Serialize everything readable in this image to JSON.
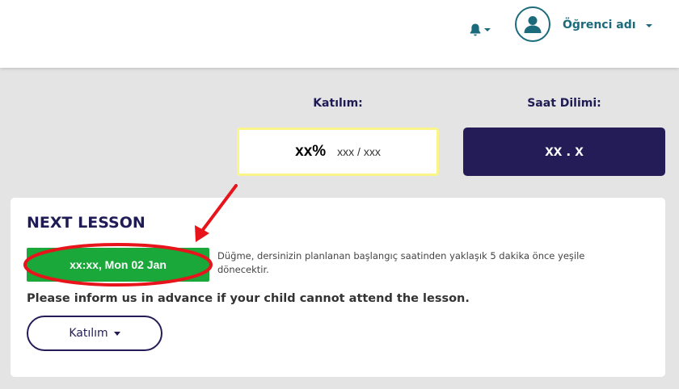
{
  "header": {
    "user_name": "Öğrenci adı",
    "icons": {
      "notifications": "bell-icon",
      "avatar": "user-avatar-icon"
    }
  },
  "stats": {
    "attendance_label": "Katılım:",
    "attendance_percent": "xx%",
    "attendance_ratio": "xxx / xxx",
    "timezone_label": "Saat Dilimi:",
    "timezone_value": "xx . x"
  },
  "next_lesson": {
    "title": "NEXT LESSON",
    "lesson_button_label": "xx:xx, Mon 02 Jan",
    "note": "Düğme, dersinizin planlanan başlangıç saatinden yaklaşık 5 dakika önce yeşile dönecektir.",
    "inform_text": "Please inform us in advance if your child cannot attend the lesson.",
    "attendance_dropdown_label": "Katılım"
  },
  "colors": {
    "brand_navy": "#231c56",
    "teal": "#1c6b7d",
    "lesson_green": "#1aa83a",
    "attendance_border": "#fbf48a",
    "annotation_red": "#e8141b"
  }
}
